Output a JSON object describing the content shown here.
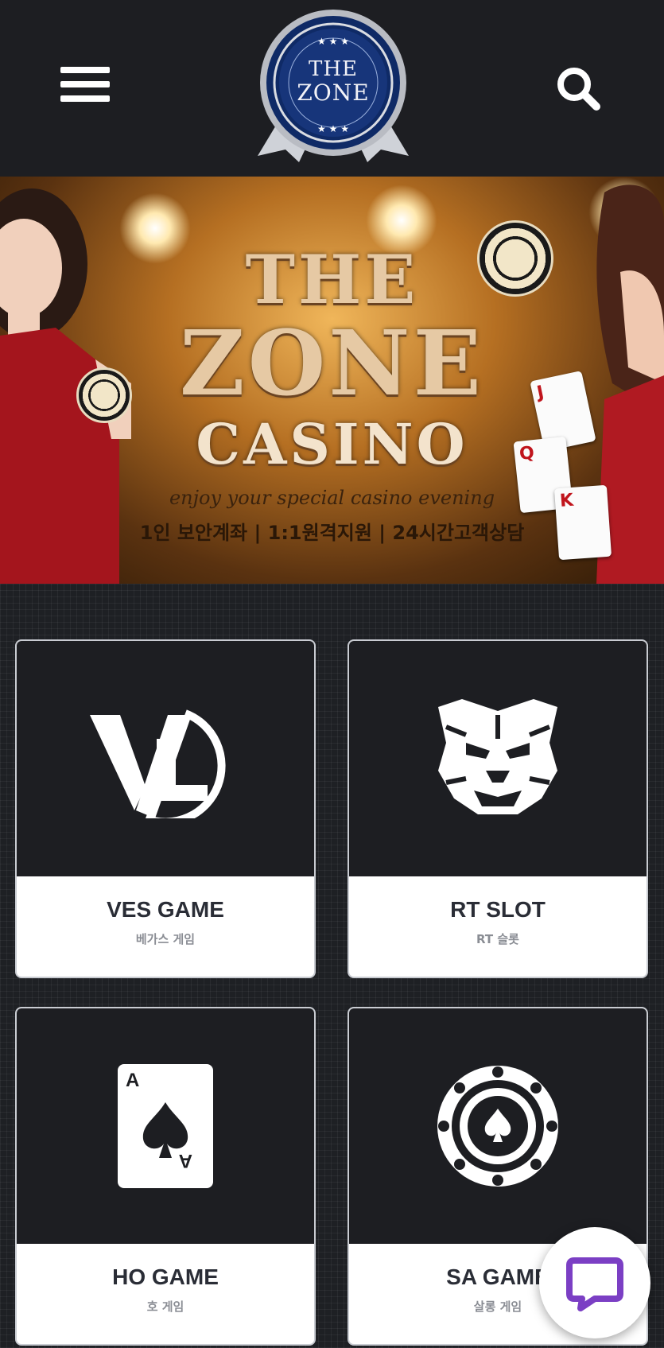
{
  "header": {
    "logo": {
      "line1": "THE",
      "line2": "ZONE"
    },
    "menu_icon": "hamburger-menu-icon",
    "search_icon": "search-icon"
  },
  "banner": {
    "title_line1": "THE",
    "title_line2": "ZONE",
    "title_line3": "CASINO",
    "tagline": "enjoy your special casino evening",
    "features": "1인 보안계좌 | 1:1원격지원 | 24시간고객상담"
  },
  "games": [
    {
      "title": "VES GAME",
      "subtitle": "베가스 게임",
      "icon": "vl-logo-icon"
    },
    {
      "title": "RT SLOT",
      "subtitle": "RT 슬롯",
      "icon": "tiger-icon"
    },
    {
      "title": "HO GAME",
      "subtitle": "호 게임",
      "icon": "ace-of-spades-icon"
    },
    {
      "title": "SA GAME",
      "subtitle": "살롱 게임",
      "icon": "poker-chip-icon"
    }
  ],
  "chat": {
    "icon": "chat-bubble-icon",
    "accent": "#7b3fc4"
  },
  "colors": {
    "background": "#1d1e22",
    "card_title": "#2a2d36",
    "card_subtitle": "#8a8d94"
  }
}
